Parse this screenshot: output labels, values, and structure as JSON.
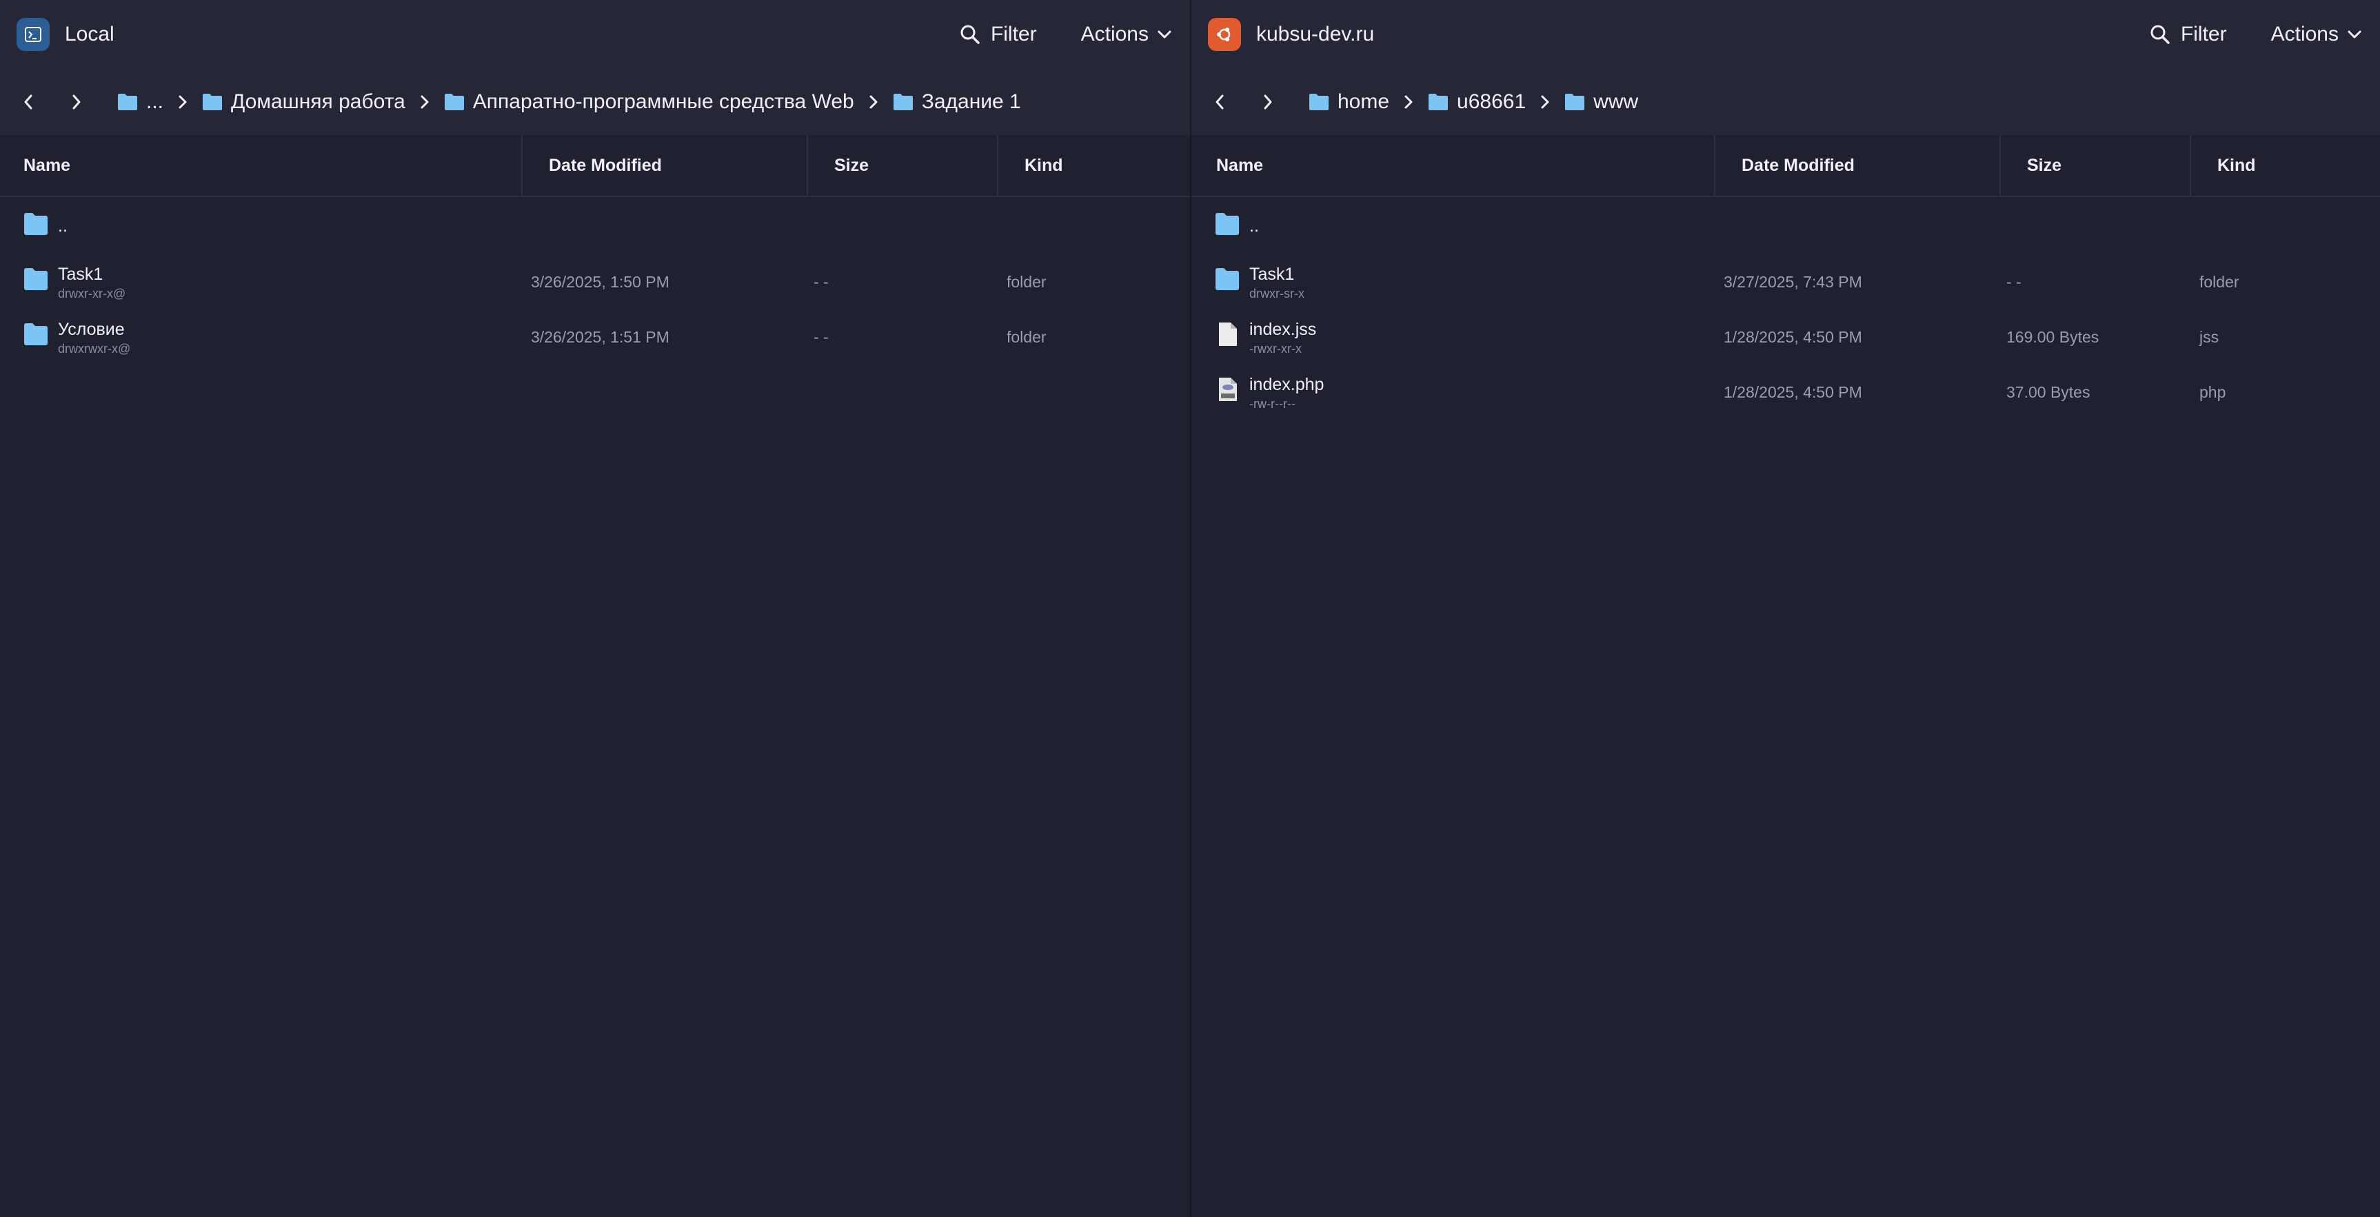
{
  "left": {
    "host": "Local",
    "filter_label": "Filter",
    "actions_label": "Actions",
    "breadcrumbs": [
      "...",
      "Домашняя работа",
      "Аппаратно-программные средства Web",
      "Задание 1"
    ],
    "columns": [
      "Name",
      "Date Modified",
      "Size",
      "Kind"
    ],
    "parent_label": "..",
    "files": [
      {
        "name": "Task1",
        "perm": "drwxr-xr-x@",
        "date": "3/26/2025, 1:50 PM",
        "size": "- -",
        "kind": "folder",
        "icon": "folder-icon"
      },
      {
        "name": "Условие",
        "perm": "drwxrwxr-x@",
        "date": "3/26/2025, 1:51 PM",
        "size": "- -",
        "kind": "folder",
        "icon": "folder-icon"
      }
    ]
  },
  "right": {
    "host": "kubsu-dev.ru",
    "filter_label": "Filter",
    "actions_label": "Actions",
    "breadcrumbs": [
      "home",
      "u68661",
      "www"
    ],
    "columns": [
      "Name",
      "Date Modified",
      "Size",
      "Kind"
    ],
    "parent_label": "..",
    "files": [
      {
        "name": "Task1",
        "perm": "drwxr-sr-x",
        "date": "3/27/2025, 7:43 PM",
        "size": "- -",
        "kind": "folder",
        "icon": "folder-icon"
      },
      {
        "name": "index.jss",
        "perm": "-rwxr-xr-x",
        "date": "1/28/2025, 4:50 PM",
        "size": "169.00 Bytes",
        "kind": "jss",
        "icon": "file-icon"
      },
      {
        "name": "index.php",
        "perm": "-rw-r--r--",
        "date": "1/28/2025, 4:50 PM",
        "size": "37.00 Bytes",
        "kind": "php",
        "icon": "php-file-icon"
      }
    ]
  },
  "colors": {
    "background": "#1f2030",
    "header": "#252736",
    "folder": "#7cc4f4",
    "local_badge": "#2c5e96",
    "remote_badge": "#e15a30"
  }
}
